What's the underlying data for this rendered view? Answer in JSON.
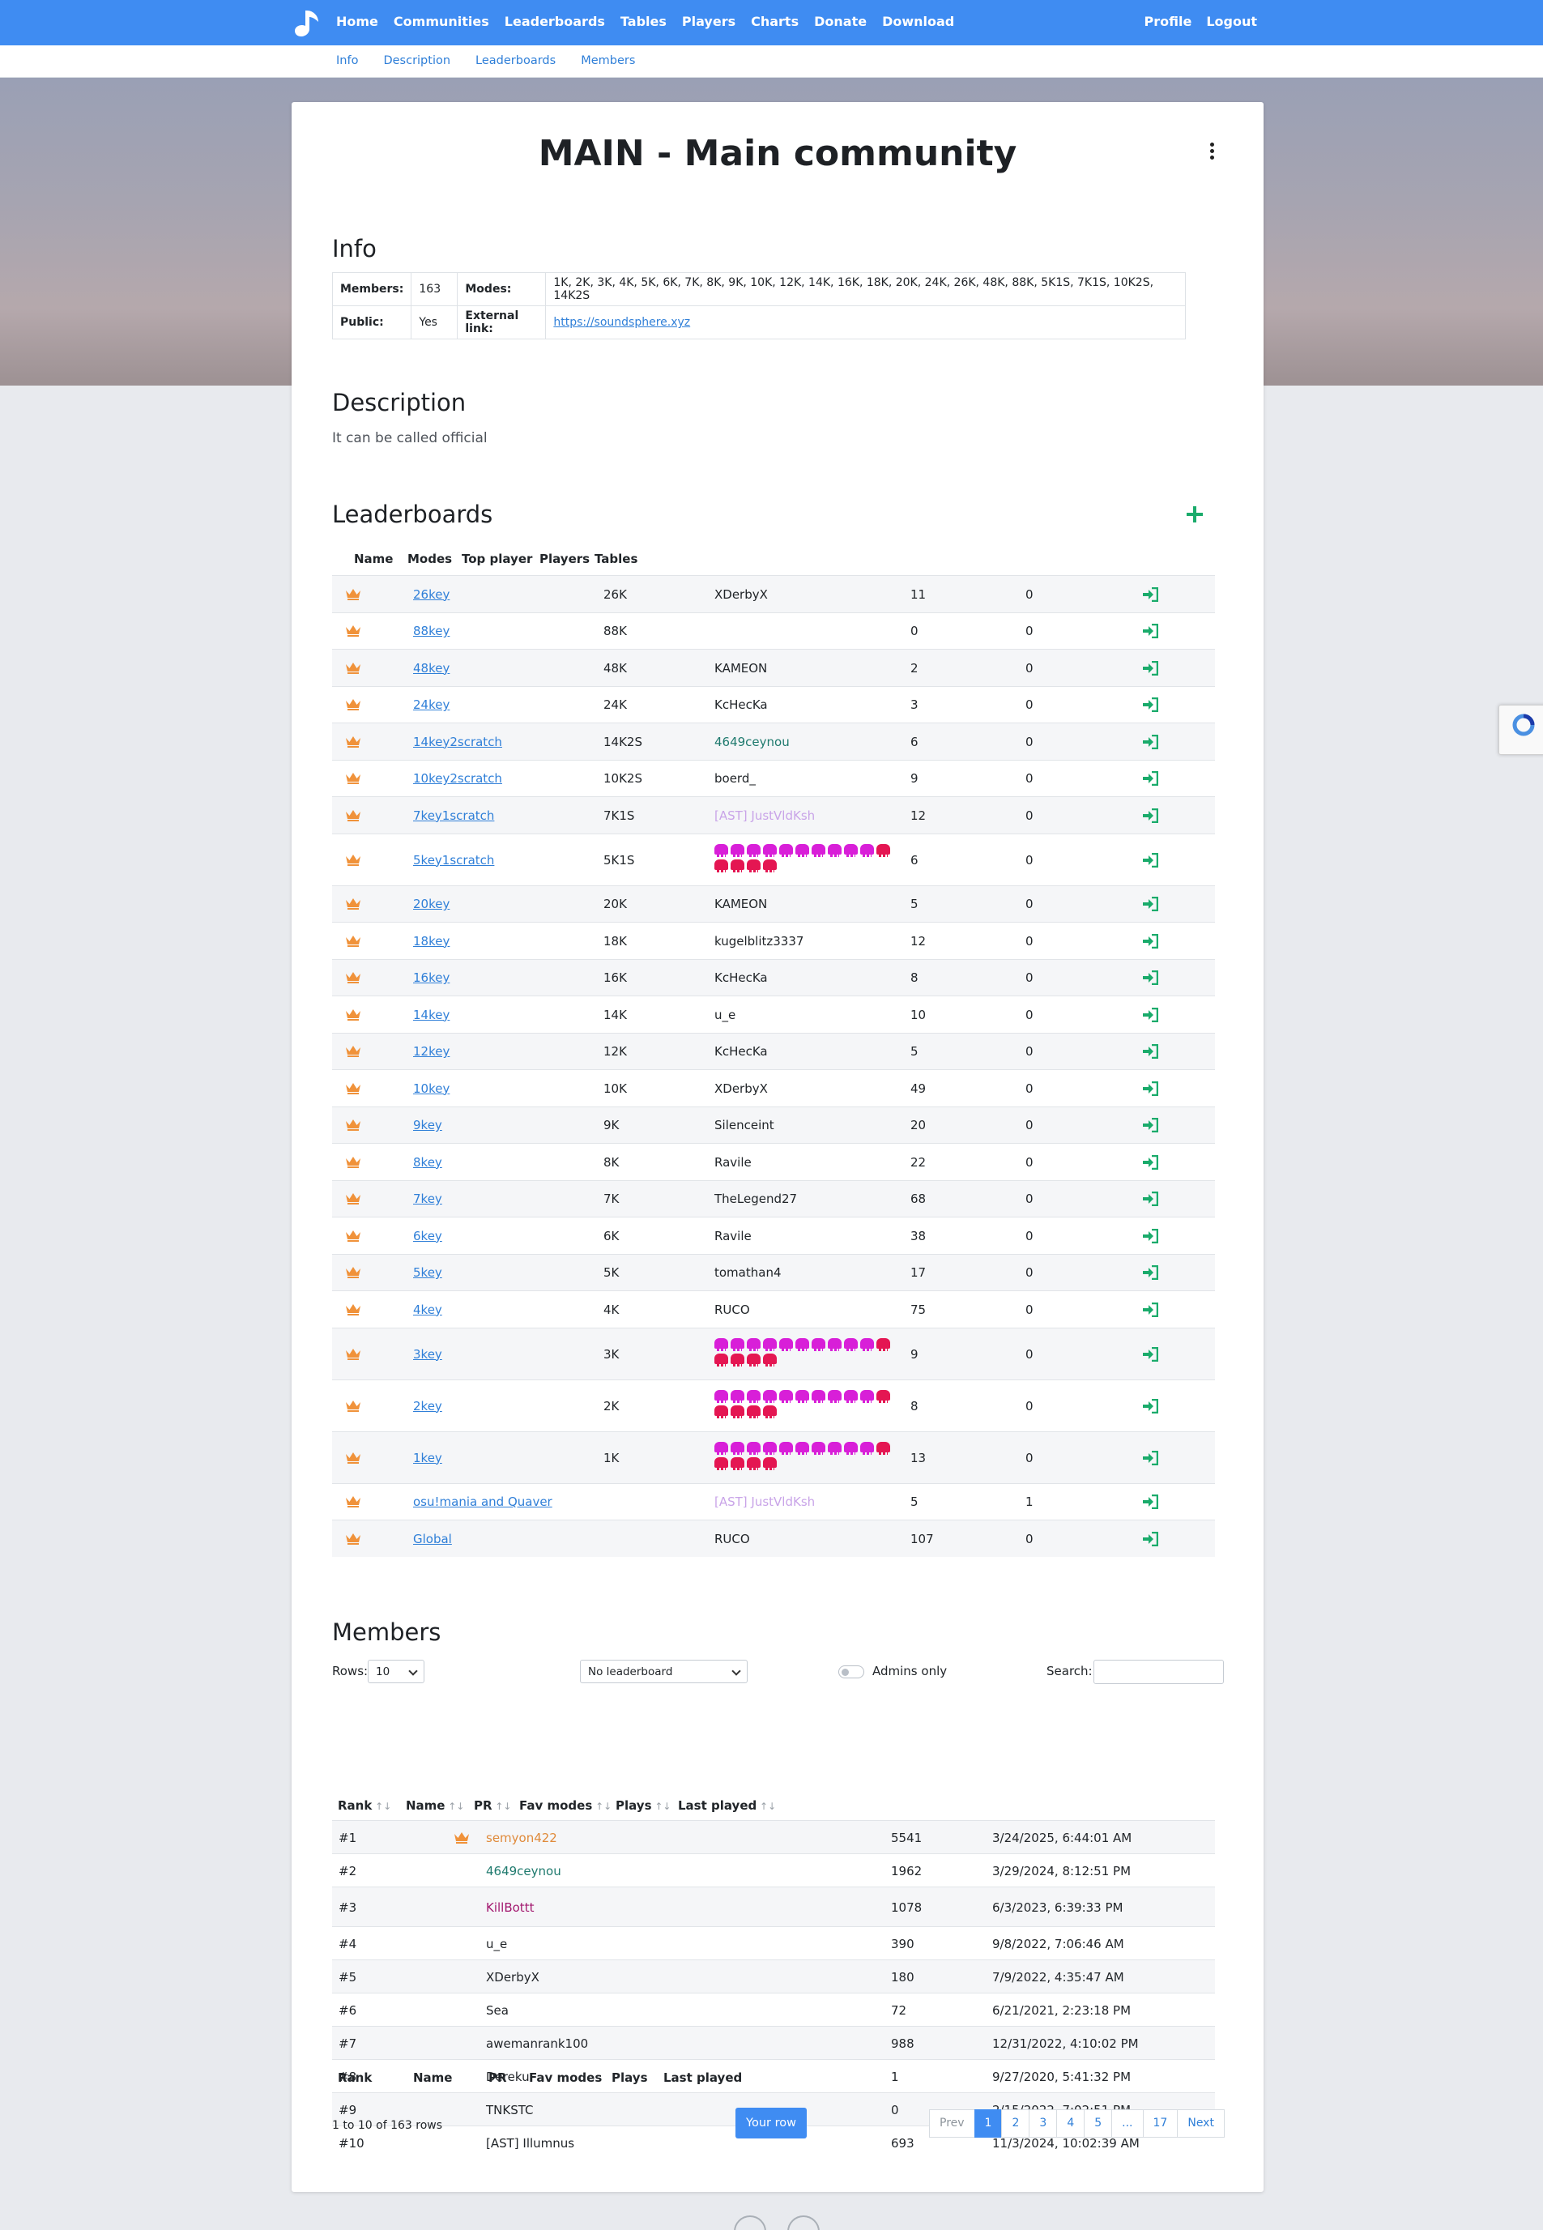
{
  "nav": {
    "links": [
      "Home",
      "Communities",
      "Leaderboards",
      "Tables",
      "Players",
      "Charts",
      "Donate",
      "Download"
    ],
    "right": [
      "Profile",
      "Logout"
    ]
  },
  "subnav": [
    "Info",
    "Description",
    "Leaderboards",
    "Members"
  ],
  "page_title": "MAIN - Main community",
  "info": {
    "heading": "Info",
    "members_label": "Members:",
    "members_value": "163",
    "modes_label": "Modes:",
    "modes_value": "1K, 2K, 3K, 4K, 5K, 6K, 7K, 8K, 9K, 10K, 12K, 14K, 16K, 18K, 20K, 24K, 26K, 48K, 88K, 5K1S, 7K1S, 10K2S, 14K2S",
    "public_label": "Public:",
    "public_value": "Yes",
    "link_label": "External link:",
    "link_value": "https://soundsphere.xyz"
  },
  "description": {
    "heading": "Description",
    "text": "It can be called official"
  },
  "leaderboards": {
    "heading": "Leaderboards",
    "columns": [
      "Name",
      "Modes",
      "Top player",
      "Players",
      "Tables"
    ],
    "rows": [
      {
        "name": "26key",
        "mode": "26K",
        "top": "XDerbyX",
        "players": "11",
        "tables": "0"
      },
      {
        "name": "88key",
        "mode": "88K",
        "top": "",
        "players": "0",
        "tables": "0"
      },
      {
        "name": "48key",
        "mode": "48K",
        "top": "KAMEON",
        "players": "2",
        "tables": "0"
      },
      {
        "name": "24key",
        "mode": "24K",
        "top": "KcHecKa",
        "players": "3",
        "tables": "0"
      },
      {
        "name": "14key2scratch",
        "mode": "14K2S",
        "top": "4649ceynou",
        "players": "6",
        "tables": "0",
        "top_color": "#1f7a6e"
      },
      {
        "name": "10key2scratch",
        "mode": "10K2S",
        "top": "boerd_",
        "players": "9",
        "tables": "0"
      },
      {
        "name": "7key1scratch",
        "mode": "7K1S",
        "top": "[AST] JustVldKsh",
        "players": "12",
        "tables": "0",
        "top_color": "#c9a4e8"
      },
      {
        "name": "5key1scratch",
        "mode": "5K1S",
        "top": "",
        "players": "6",
        "tables": "0",
        "emoji": true
      },
      {
        "name": "20key",
        "mode": "20K",
        "top": "KAMEON",
        "players": "5",
        "tables": "0"
      },
      {
        "name": "18key",
        "mode": "18K",
        "top": "kugelblitz3337",
        "players": "12",
        "tables": "0"
      },
      {
        "name": "16key",
        "mode": "16K",
        "top": "KcHecKa",
        "players": "8",
        "tables": "0"
      },
      {
        "name": "14key",
        "mode": "14K",
        "top": "u_e",
        "players": "10",
        "tables": "0"
      },
      {
        "name": "12key",
        "mode": "12K",
        "top": "KcHecKa",
        "players": "5",
        "tables": "0"
      },
      {
        "name": "10key",
        "mode": "10K",
        "top": "XDerbyX",
        "players": "49",
        "tables": "0"
      },
      {
        "name": "9key",
        "mode": "9K",
        "top": "Silenceint",
        "players": "20",
        "tables": "0"
      },
      {
        "name": "8key",
        "mode": "8K",
        "top": "Ravile",
        "players": "22",
        "tables": "0"
      },
      {
        "name": "7key",
        "mode": "7K",
        "top": "TheLegend27",
        "players": "68",
        "tables": "0"
      },
      {
        "name": "6key",
        "mode": "6K",
        "top": "Ravile",
        "players": "38",
        "tables": "0"
      },
      {
        "name": "5key",
        "mode": "5K",
        "top": "tomathan4",
        "players": "17",
        "tables": "0"
      },
      {
        "name": "4key",
        "mode": "4K",
        "top": "RUCO",
        "players": "75",
        "tables": "0"
      },
      {
        "name": "3key",
        "mode": "3K",
        "top": "",
        "players": "9",
        "tables": "0",
        "emoji": true
      },
      {
        "name": "2key",
        "mode": "2K",
        "top": "",
        "players": "8",
        "tables": "0",
        "emoji": true
      },
      {
        "name": "1key",
        "mode": "1K",
        "top": "",
        "players": "13",
        "tables": "0",
        "emoji": true
      },
      {
        "name": "osu!mania and Quaver",
        "mode": "",
        "top": "[AST] JustVldKsh",
        "players": "5",
        "tables": "1",
        "top_color": "#c9a4e8"
      },
      {
        "name": "Global",
        "mode": "",
        "top": "RUCO",
        "players": "107",
        "tables": "0"
      }
    ]
  },
  "members": {
    "heading": "Members",
    "rows_label": "Rows:",
    "rows_value": "10",
    "leaderboard_select": "No leaderboard",
    "admins_label": "Admins only",
    "search_label": "Search:",
    "columns": [
      "Rank",
      "Name",
      "PR",
      "Fav modes",
      "Plays",
      "Last played"
    ],
    "sort_glyphs": [
      "↑↓",
      "↑↓",
      "↑↓",
      "↑↓",
      "↑↓",
      "↑↓"
    ],
    "rows": [
      {
        "rank": "#1",
        "name": "semyon422",
        "plays": "5541",
        "last": "3/24/2025, 6:44:01 AM",
        "color": "#e08a3a",
        "crown": true
      },
      {
        "rank": "#2",
        "name": "4649ceynou",
        "plays": "1962",
        "last": "3/29/2024, 8:12:51 PM",
        "color": "#1f7a6e"
      },
      {
        "rank": "#3",
        "name": "KillBottt",
        "plays": "1078",
        "last": "6/3/2023, 6:39:33 PM",
        "color": "#a3186f"
      },
      {
        "rank": "#4",
        "name": "u_e",
        "plays": "390",
        "last": "9/8/2022, 7:06:46 AM"
      },
      {
        "rank": "#5",
        "name": "XDerbyX",
        "plays": "180",
        "last": "7/9/2022, 4:35:47 AM"
      },
      {
        "rank": "#6",
        "name": "Sea",
        "plays": "72",
        "last": "6/21/2021, 2:23:18 PM"
      },
      {
        "rank": "#7",
        "name": "awemanrank100",
        "plays": "988",
        "last": "12/31/2022, 4:10:02 PM"
      },
      {
        "rank": "#8",
        "name": "Dereku",
        "plays": "1",
        "last": "9/27/2020, 5:41:32 PM"
      },
      {
        "rank": "#9",
        "name": "TNKSTC",
        "plays": "0",
        "last": "2/15/2022, 7:02:51 PM"
      },
      {
        "rank": "#10",
        "name": "[AST] Illumnus",
        "plays": "693",
        "last": "11/3/2024, 10:02:39 AM"
      }
    ],
    "footer_columns": [
      "Rank",
      "Name",
      "PR",
      "Fav modes",
      "Plays",
      "Last played"
    ],
    "summary": "1 to 10 of 163 rows",
    "your_row": "Your row",
    "pagination": [
      "Prev",
      "1",
      "2",
      "3",
      "4",
      "5",
      "...",
      "17",
      "Next"
    ]
  },
  "colors": {
    "accent": "#3f8cf2",
    "crown": "#f0923a",
    "enter": "#1aab6b"
  }
}
